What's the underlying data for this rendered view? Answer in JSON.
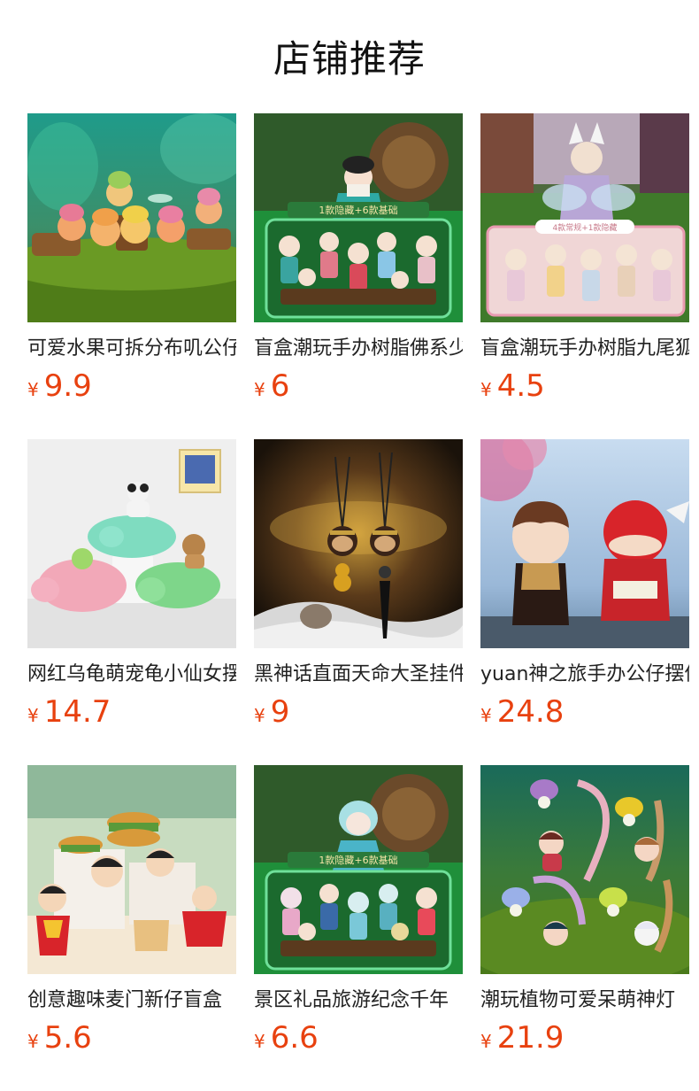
{
  "header": {
    "title": "店铺推荐"
  },
  "products": [
    {
      "name": "可爱水果可拆分布叽公仔",
      "currency": "¥",
      "price": "9.9",
      "image": "fruit-figures-on-moss"
    },
    {
      "name": "盲盒潮玩手办树脂佛系少女",
      "currency": "¥",
      "price": "6",
      "image": "blind-box-girl-figures"
    },
    {
      "name": "盲盒潮玩手办树脂九尾狐",
      "currency": "¥",
      "price": "4.5",
      "image": "nine-tail-fox-figures"
    },
    {
      "name": "网红乌龟萌宠龟小仙女摆件",
      "currency": "¥",
      "price": "14.7",
      "image": "stacked-turtle-figures"
    },
    {
      "name": "黑神话直面天命大圣挂件",
      "currency": "¥",
      "price": "9",
      "image": "monkey-king-pendants"
    },
    {
      "name": "yuan神之旅手办公仔摆件",
      "currency": "¥",
      "price": "24.8",
      "image": "anime-character-figures"
    },
    {
      "name": "创意趣味麦门新仔盲盒",
      "currency": "¥",
      "price": "5.6",
      "image": "burger-boy-figures"
    },
    {
      "name": "景区礼品旅游纪念千年",
      "currency": "¥",
      "price": "6.6",
      "image": "mermaid-blind-box-figures"
    },
    {
      "name": "潮玩植物可爱呆萌神灯",
      "currency": "¥",
      "price": "21.9",
      "image": "flower-lamp-figures"
    }
  ],
  "labels": {
    "box_banner_1": "1款隐藏+6款基础",
    "box_banner_2": "4款常规+1款隐藏",
    "box_banner_3": "1款隐藏+6款基础"
  }
}
